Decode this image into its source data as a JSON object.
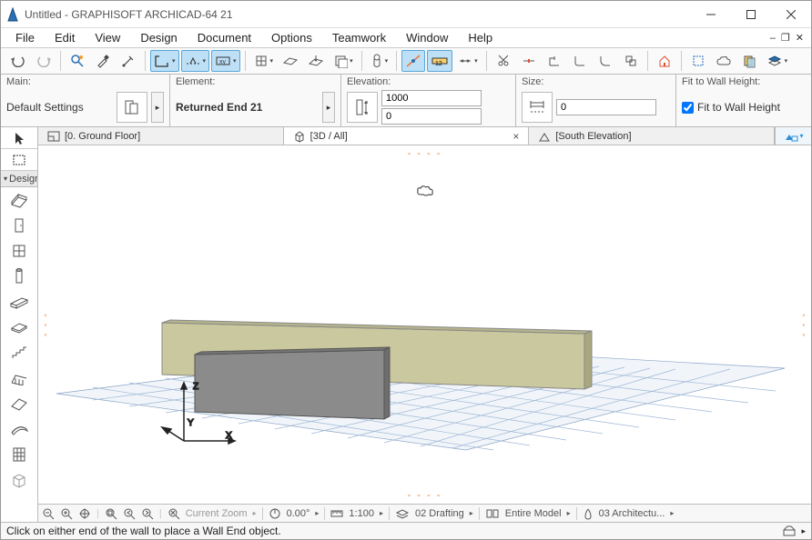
{
  "title": "Untitled - GRAPHISOFT ARCHICAD-64 21",
  "menu": [
    "File",
    "Edit",
    "View",
    "Design",
    "Document",
    "Options",
    "Teamwork",
    "Window",
    "Help"
  ],
  "infobox": {
    "main_label": "Main:",
    "main_value": "Default Settings",
    "element_label": "Element:",
    "element_value": "Returned End 21",
    "elevation_label": "Elevation:",
    "elev_top": "1000",
    "elev_bottom": "0",
    "size_label": "Size:",
    "size_value": "0",
    "fit_label": "Fit to Wall Height:",
    "fit_check": "Fit to Wall Height"
  },
  "left": {
    "design": "Design"
  },
  "tabs": {
    "t0": "[0. Ground Floor]",
    "t1": "[3D / All]",
    "t2": "[South Elevation]"
  },
  "axes": {
    "x": "X",
    "y": "Y",
    "z": "Z"
  },
  "scalerow": {
    "zoom_label": "Current Zoom",
    "angle": "0.00°",
    "scale": "1:100",
    "layer": "02 Drafting",
    "model": "Entire Model",
    "discipline": "03 Architectu..."
  },
  "status": "Click on either end of the wall to place a Wall End object."
}
